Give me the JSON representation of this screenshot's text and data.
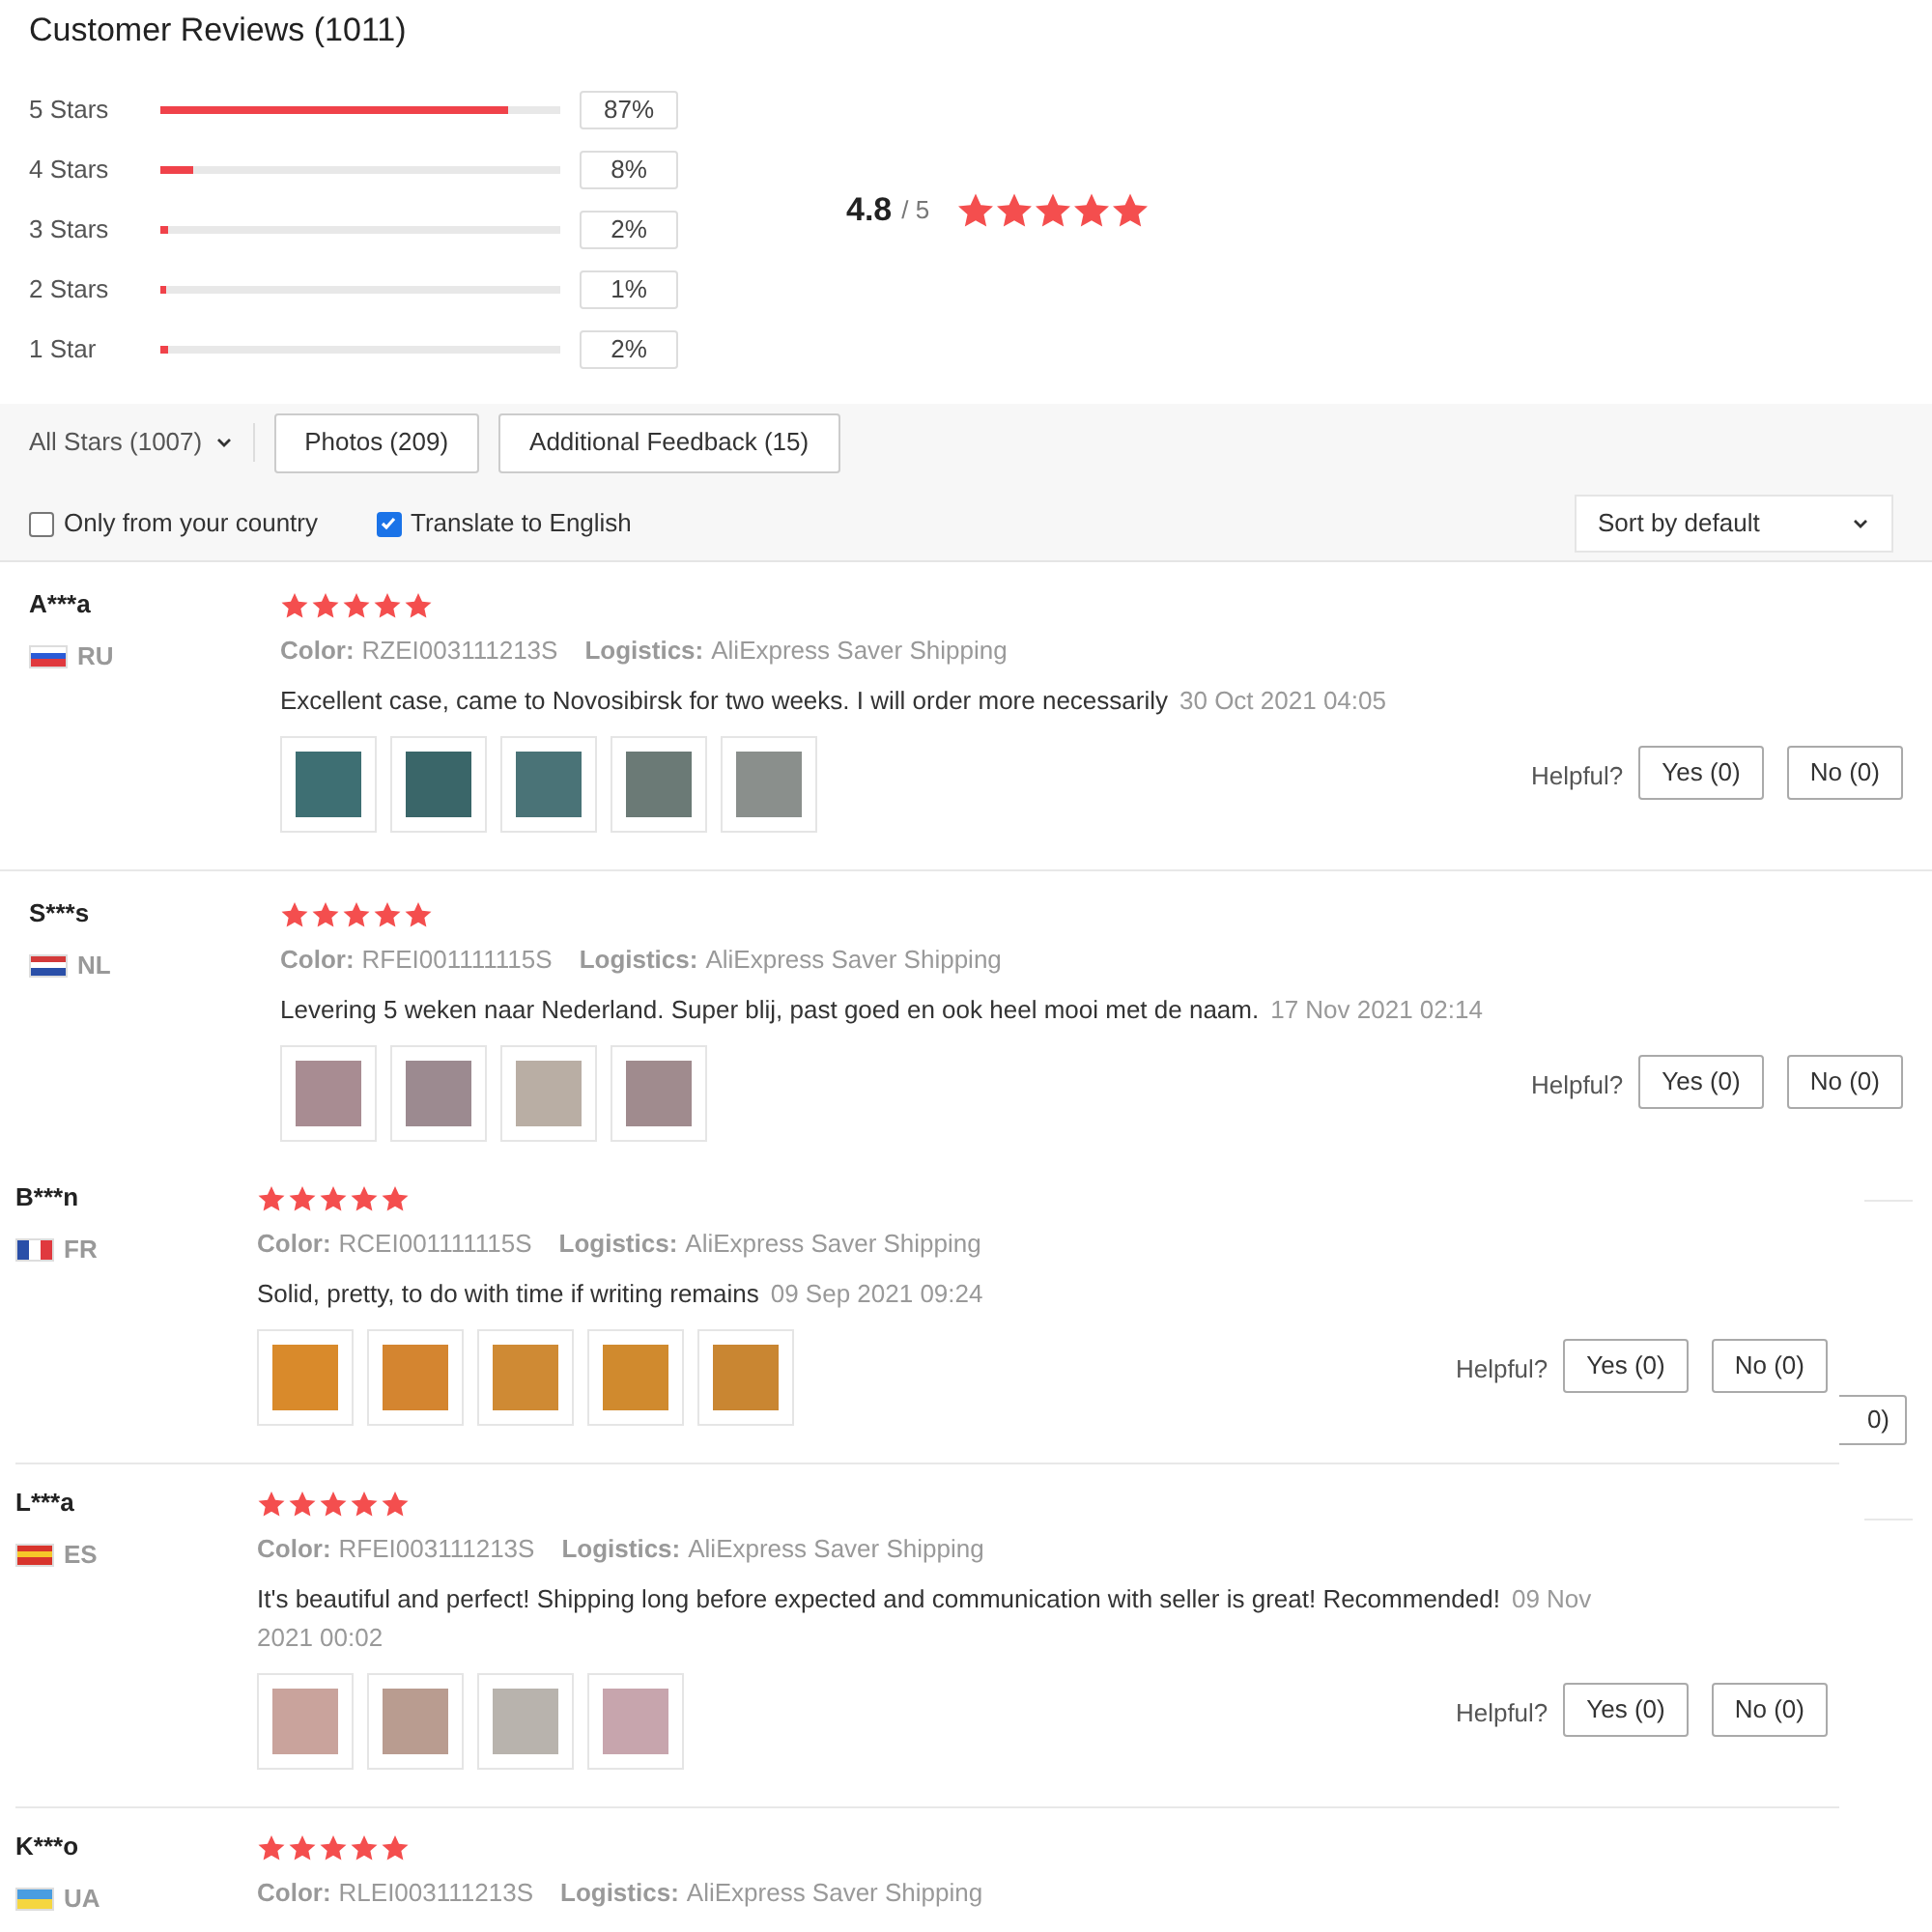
{
  "title": "Customer Reviews (1011)",
  "distribution": [
    {
      "label": "5 Stars",
      "level": 0.87,
      "percent": "87%"
    },
    {
      "label": "4 Stars",
      "level": 0.08,
      "percent": "8%"
    },
    {
      "label": "3 Stars",
      "level": 0.02,
      "percent": "2%"
    },
    {
      "label": "2 Stars",
      "level": 0.01,
      "percent": "1%"
    },
    {
      "label": "1 Star",
      "level": 0.02,
      "percent": "2%"
    }
  ],
  "rating": {
    "value": "4.8",
    "out_of": "/ 5",
    "stars": 5
  },
  "filters": {
    "star_filter": "All Stars (1007)",
    "buttons": [
      "Photos (209)",
      "Additional Feedback (15)"
    ],
    "checkboxes": [
      {
        "label": "Only from your country",
        "checked": false
      },
      {
        "label": "Translate to English",
        "checked": true
      }
    ],
    "sort": "Sort by default"
  },
  "reviews": [
    {
      "name": "A***a",
      "country": "RU",
      "flag": {
        "kind": "horizontal",
        "stripes": [
          {
            "color": "#ffffff"
          },
          {
            "color": "#2a5bd7"
          },
          {
            "color": "#e0393e"
          }
        ]
      },
      "stars": 5,
      "color_label": "Color:",
      "color_value": "RZEI003111213S",
      "logistics_label": "Logistics:",
      "logistics_value": "AliExpress Saver Shipping",
      "text": "Excellent case, came to Novosibirsk for two weeks. I will order more necessarily",
      "date": "30 Oct 2021 04:05",
      "photos": [
        {
          "color": "#3e6f73"
        },
        {
          "color": "#3a6669"
        },
        {
          "color": "#4a7377"
        },
        {
          "color": "#6b7a76"
        },
        {
          "color": "#8a8f8c"
        }
      ],
      "helpful": "Helpful?",
      "yes": "Yes (0)",
      "no": "No (0)"
    },
    {
      "name": "S***s",
      "country": "NL",
      "flag": {
        "kind": "horizontal",
        "stripes": [
          {
            "color": "#d33a3a"
          },
          {
            "color": "#ffffff"
          },
          {
            "color": "#2a4fa8"
          }
        ]
      },
      "stars": 5,
      "color_label": "Color:",
      "color_value": "RFEI001111115S",
      "logistics_label": "Logistics:",
      "logistics_value": "AliExpress Saver Shipping",
      "text": "Levering 5 weken naar Nederland. Super blij, past goed en ook heel mooi met de naam.",
      "date": "17 Nov 2021 02:14",
      "photos": [
        {
          "color": "#a88c92"
        },
        {
          "color": "#9c8a90"
        },
        {
          "color": "#b9aea4"
        },
        {
          "color": "#a08b8e"
        }
      ],
      "helpful": "Helpful?",
      "yes": "Yes (0)",
      "no": "No (0)"
    }
  ],
  "overlay_reviews": [
    {
      "name": "B***n",
      "country": "FR",
      "flag": {
        "kind": "vertical",
        "stripes": [
          {
            "color": "#2a4fa8"
          },
          {
            "color": "#ffffff"
          },
          {
            "color": "#e0393e"
          }
        ]
      },
      "stars": 5,
      "color_label": "Color:",
      "color_value": "RCEI001111115S",
      "logistics_label": "Logistics:",
      "logistics_value": "AliExpress Saver Shipping",
      "text": "Solid, pretty, to do with time if writing remains",
      "date": "09 Sep 2021 09:24",
      "photos": [
        {
          "color": "#d98a2b"
        },
        {
          "color": "#d48530"
        },
        {
          "color": "#cf8a34"
        },
        {
          "color": "#d08a2e"
        },
        {
          "color": "#c98632"
        }
      ],
      "helpful": "Helpful?",
      "yes": "Yes (0)",
      "no": "No (0)"
    },
    {
      "name": "L***a",
      "country": "ES",
      "flag": {
        "kind": "horizontal",
        "stripes": [
          {
            "color": "#d8342c"
          },
          {
            "color": "#f6c829"
          },
          {
            "color": "#d8342c"
          }
        ]
      },
      "stars": 5,
      "color_label": "Color:",
      "color_value": "RFEI003111213S",
      "logistics_label": "Logistics:",
      "logistics_value": "AliExpress Saver Shipping",
      "text": "It's beautiful and perfect! Shipping long before expected and communication with seller is great! Recommended!",
      "date": "09 Nov 2021 00:02",
      "photos": [
        {
          "color": "#c9a39c"
        },
        {
          "color": "#b99c90"
        },
        {
          "color": "#b8b3ad"
        },
        {
          "color": "#c7a5ad"
        }
      ],
      "helpful": "Helpful?",
      "yes": "Yes (0)",
      "no": "No (0)"
    },
    {
      "name": "K***o",
      "country": "UA",
      "flag": {
        "kind": "horizontal",
        "stripes": [
          {
            "color": "#4a9de0"
          },
          {
            "color": "#f5d640"
          }
        ]
      },
      "stars": 5,
      "color_label": "Color:",
      "color_value": "RLEI003111213S",
      "logistics_label": "Logistics:",
      "logistics_value": "AliExpress Saver Shipping"
    }
  ],
  "underlying_fragment": "0)"
}
